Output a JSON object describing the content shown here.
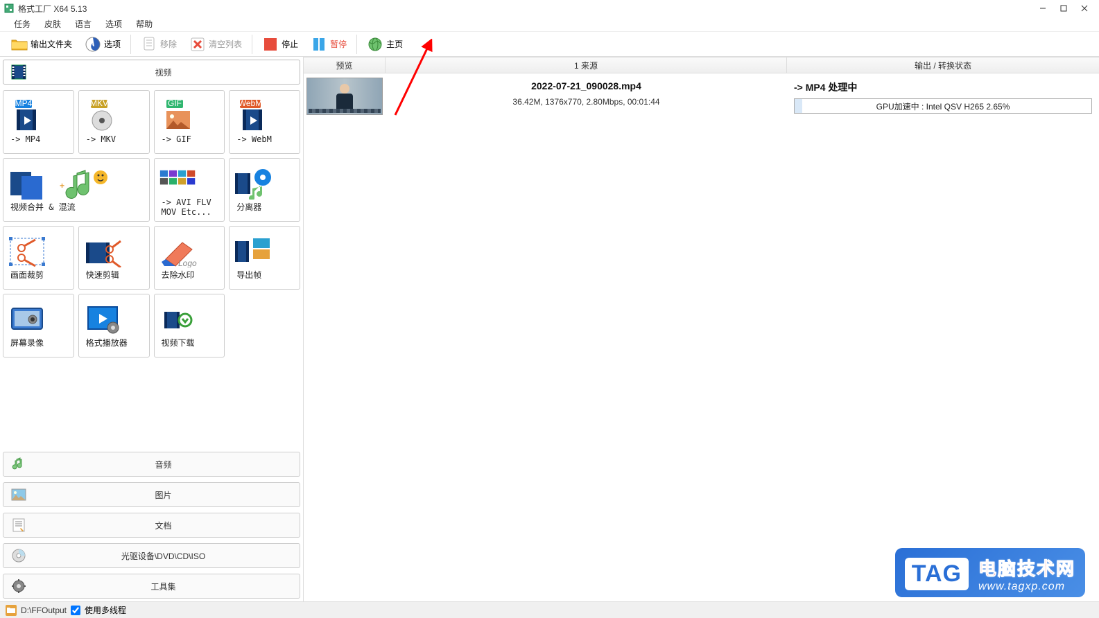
{
  "window": {
    "title": "格式工厂 X64 5.13"
  },
  "menu": {
    "items": [
      "任务",
      "皮肤",
      "语言",
      "选项",
      "帮助"
    ]
  },
  "toolbar": {
    "output_folder": "输出文件夹",
    "options": "选项",
    "remove": "移除",
    "clear_list": "清空列表",
    "stop": "停止",
    "pause": "暂停",
    "home": "主页"
  },
  "sidebar": {
    "video": "视频",
    "audio": "音频",
    "picture": "图片",
    "document": "文档",
    "disc": "光驱设备\\DVD\\CD\\ISO",
    "tools": "工具集",
    "video_tools": [
      {
        "id": "mp4",
        "label": "-> MP4"
      },
      {
        "id": "mkv",
        "label": "-> MKV"
      },
      {
        "id": "gif",
        "label": "-> GIF"
      },
      {
        "id": "webm",
        "label": "-> WebM"
      },
      {
        "id": "merge",
        "label": "视频合并 & 混流",
        "wide": true
      },
      {
        "id": "aviflv",
        "label": "-> AVI FLV\nMOV Etc..."
      },
      {
        "id": "demux",
        "label": "分离器"
      },
      {
        "id": "crop",
        "label": "画面裁剪"
      },
      {
        "id": "quick",
        "label": "快速剪辑"
      },
      {
        "id": "rmwm",
        "label": "去除水印"
      },
      {
        "id": "frames",
        "label": "导出帧"
      },
      {
        "id": "screc",
        "label": "屏幕录像"
      },
      {
        "id": "player",
        "label": "格式播放器"
      },
      {
        "id": "dl",
        "label": "视频下载"
      }
    ]
  },
  "headers": {
    "preview": "预览",
    "source_prefix": "1 来源",
    "output": "输出 / 转换状态"
  },
  "task": {
    "filename": "2022-07-21_090028.mp4",
    "meta": "36.42M, 1376x770, 2.80Mbps, 00:01:44",
    "out_status": "-> MP4 处理中",
    "progress_text": "GPU加速中 : Intel QSV H265 2.65%",
    "progress_pct": 2.65
  },
  "statusbar": {
    "path": "D:\\FFOutput",
    "multithread": "使用多线程",
    "checked": true
  },
  "watermark": {
    "tag": "TAG",
    "line1": "电脑技术网",
    "line2": "www.tagxp.com"
  }
}
